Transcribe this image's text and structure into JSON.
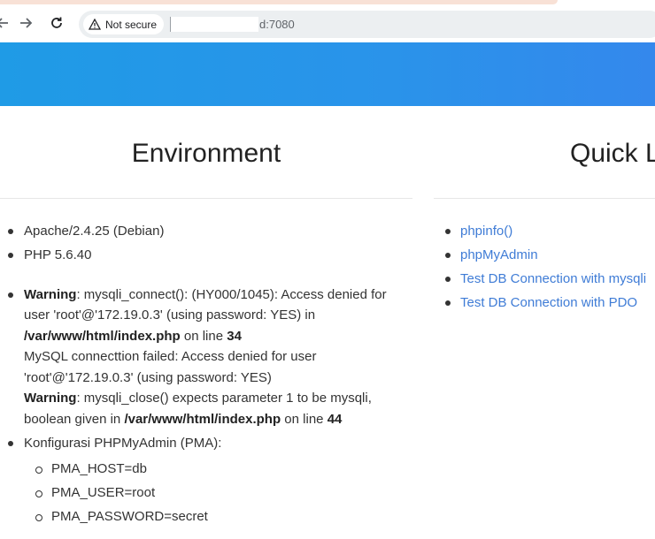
{
  "browser": {
    "security_label": "Not secure",
    "url_suffix": "d:7080"
  },
  "environment": {
    "title": "Environment",
    "server": "Apache/2.4.25 (Debian)",
    "php": "PHP 5.6.40",
    "warning1": {
      "label": "Warning",
      "text1": ": mysqli_connect(): (HY000/1045): Access denied for user 'root'@'172.19.0.3' (using password: YES) in ",
      "file": "/var/www/html/index.php",
      "text2": " on line ",
      "line": "34"
    },
    "mysql_fail": "MySQL connecttion failed: Access denied for user 'root'@'172.19.0.3' (using password: YES)",
    "warning2": {
      "label": "Warning",
      "text1": ": mysqli_close() expects parameter 1 to be mysqli, boolean given in ",
      "file": "/var/www/html/index.php",
      "text2": " on line ",
      "line": "44"
    },
    "pma_label": "Konfigurasi PHPMyAdmin (PMA):",
    "pma": [
      "PMA_HOST=db",
      "PMA_USER=root",
      "PMA_PASSWORD=secret"
    ]
  },
  "quick_links": {
    "title": "Quick L",
    "items": [
      "phpinfo()",
      "phpMyAdmin",
      "Test DB Connection with mysqli",
      "Test DB Connection with PDO"
    ]
  },
  "colors": {
    "banner_start": "#1f9be6",
    "banner_end": "#3488ec",
    "link": "#3f7cd6"
  }
}
